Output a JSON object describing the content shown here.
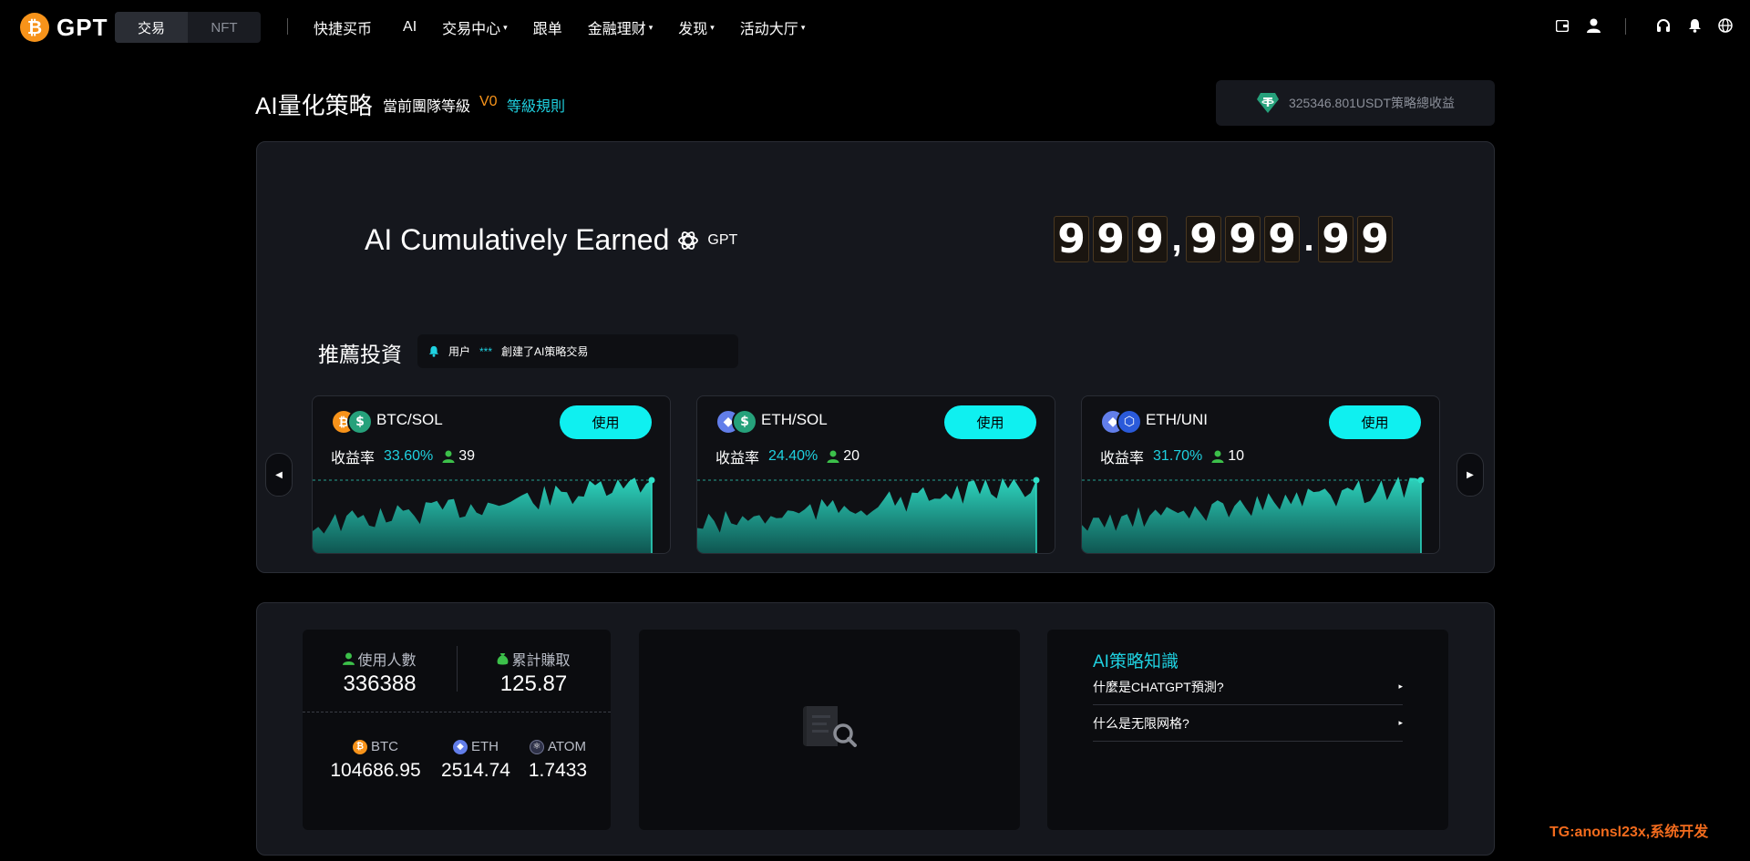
{
  "brand": {
    "logo_symbol": "₿",
    "name": "GPT"
  },
  "nav": {
    "segments": [
      {
        "label": "交易",
        "active": true
      },
      {
        "label": "NFT",
        "active": false
      }
    ],
    "menu": [
      {
        "label": "快捷买币",
        "dropdown": false
      },
      {
        "label": "AI",
        "dropdown": false
      },
      {
        "label": "交易中心",
        "dropdown": true
      },
      {
        "label": "跟单",
        "dropdown": false
      },
      {
        "label": "金融理财",
        "dropdown": true
      },
      {
        "label": "发现",
        "dropdown": true
      },
      {
        "label": "活动大厅",
        "dropdown": true
      }
    ],
    "caret": "▾",
    "right_icons": [
      "wallet-icon",
      "user-icon",
      "headset-icon",
      "bell-icon",
      "globe-icon"
    ]
  },
  "header": {
    "title": "AI量化策略",
    "team_label": "當前團隊等級",
    "team_level": "V0",
    "level_rules": "等級規則",
    "earnings": "325346.801USDT策略總收益"
  },
  "hero": {
    "title": "AI Cumulatively Earned",
    "gpt_label": "GPT",
    "counter": [
      "9",
      "9",
      "9",
      ",",
      "9",
      "9",
      "9",
      ".",
      "9",
      "9"
    ]
  },
  "recommend": {
    "title": "推薦投資",
    "notice": {
      "prefix": "用户",
      "masked": "***",
      "suffix": "創建了AI策略交易"
    }
  },
  "cards": [
    {
      "pair": "BTC/SOL",
      "rate_label": "收益率",
      "rate": "33.60%",
      "users": "39",
      "button": "使用",
      "coins": [
        {
          "symbol": "₿",
          "color": "#f7931a"
        },
        {
          "symbol": "$",
          "color": "#26a17b"
        }
      ]
    },
    {
      "pair": "ETH/SOL",
      "rate_label": "收益率",
      "rate": "24.40%",
      "users": "20",
      "button": "使用",
      "coins": [
        {
          "symbol": "◆",
          "color": "#627eea"
        },
        {
          "symbol": "$",
          "color": "#26a17b"
        }
      ]
    },
    {
      "pair": "ETH/UNI",
      "rate_label": "收益率",
      "rate": "31.70%",
      "users": "10",
      "button": "使用",
      "coins": [
        {
          "symbol": "◆",
          "color": "#627eea"
        },
        {
          "symbol": "⬡",
          "color": "#2a5ada"
        }
      ]
    }
  ],
  "stats": {
    "users_label": "使用人數",
    "users_value": "336388",
    "earned_label": "累計賺取",
    "earned_value": "125.87",
    "coins": [
      {
        "name": "BTC",
        "value": "104686.95",
        "symbol": "₿",
        "color": "#f7931a"
      },
      {
        "name": "ETH",
        "value": "2514.74",
        "symbol": "◆",
        "color": "#627eea"
      },
      {
        "name": "ATOM",
        "value": "1.7433",
        "symbol": "⚛",
        "color": "#2e3148"
      }
    ]
  },
  "knowledge": {
    "title": "AI策略知識",
    "items": [
      "什麼是CHATGPT預測?",
      "什么是无限网格?"
    ],
    "arrow": "▸"
  },
  "watermark": "TG:anonsl23x,系统开发",
  "colors": {
    "accent": "#0ff0f0",
    "teal_text": "#1fd1e0",
    "orange": "#f7931a",
    "panel": "#15171d"
  }
}
